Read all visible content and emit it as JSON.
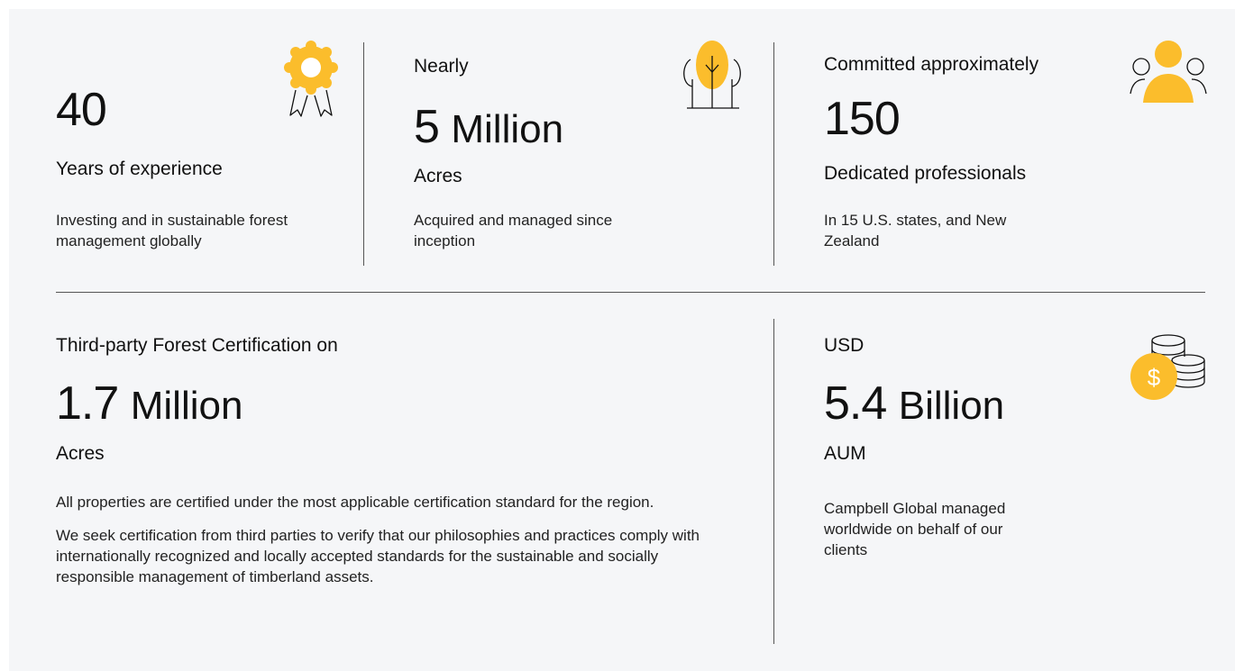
{
  "stats_top": [
    {
      "prefix": "",
      "number": "40",
      "unit": "",
      "subtitle": "Years of experience",
      "description": "Investing and in sustainable forest management globally",
      "icon": "award-ribbon-icon"
    },
    {
      "prefix": "Nearly",
      "number": "5",
      "unit": "Million",
      "subtitle": "Acres",
      "description": "Acquired and managed since inception",
      "icon": "trees-icon"
    },
    {
      "prefix": "Committed approximately",
      "number": "150",
      "unit": "",
      "subtitle": "Dedicated professionals",
      "description": "In 15 U.S. states, and New Zealand",
      "icon": "people-icon"
    }
  ],
  "stats_bottom": [
    {
      "prefix": "Third-party Forest Certification on",
      "number": "1.7",
      "unit": "Million",
      "subtitle": "Acres",
      "paragraphs": [
        "All properties are certified under the most applicable certification standard for the region.",
        "We seek certification from third parties to verify that our philosophies and practices comply with internationally recognized and locally accepted standards for the sustainable and socially responsible management of timberland assets."
      ],
      "icon": ""
    },
    {
      "prefix": "USD",
      "number": "5.4",
      "unit": "Billion",
      "subtitle": "AUM",
      "description": "Campbell Global managed worldwide on behalf of our clients",
      "icon": "coins-icon"
    }
  ],
  "colors": {
    "accent": "#fbbd2c",
    "background": "#f5f6f8",
    "text": "#111111",
    "divider": "#555555"
  }
}
